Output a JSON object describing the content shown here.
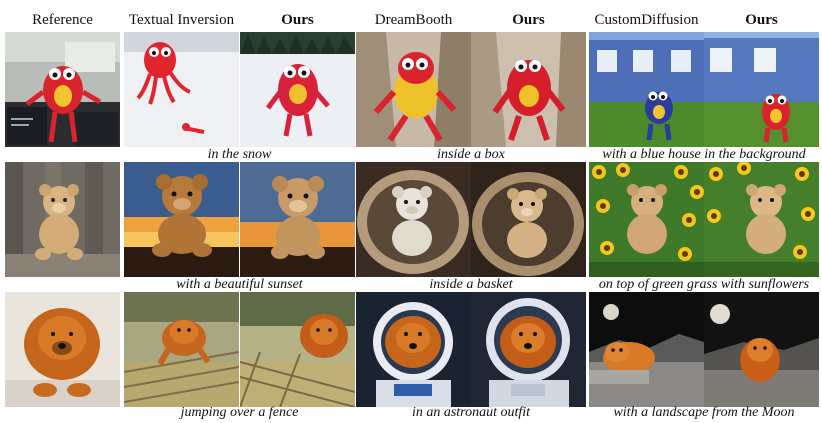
{
  "headers": {
    "reference": "Reference",
    "textual_inversion": "Textual Inversion",
    "ours_1": "Ours",
    "dreambooth": "DreamBooth",
    "ours_2": "Ours",
    "custom_diffusion": "CustomDiffusion",
    "ours_3": "Ours"
  },
  "rows": [
    {
      "subject": "red plush monster toy",
      "captions": [
        "in the snow",
        "inside a box",
        "with a blue house in the background"
      ]
    },
    {
      "subject": "teddy bear",
      "captions": [
        "with a beautiful sunset",
        "inside a basket",
        "on top of green grass with sunflowers"
      ]
    },
    {
      "subject": "chow chow dog",
      "captions": [
        "jumping over a fence",
        "in an astronaut outfit",
        "with a landscape from the Moon"
      ]
    }
  ]
}
